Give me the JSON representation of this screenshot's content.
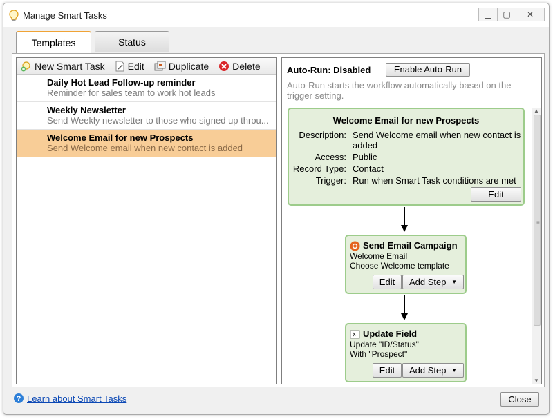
{
  "window": {
    "title": "Manage Smart Tasks"
  },
  "tabs": [
    {
      "label": "Templates"
    },
    {
      "label": "Status"
    }
  ],
  "toolbar": {
    "new_label": "New Smart Task",
    "edit_label": "Edit",
    "duplicate_label": "Duplicate",
    "delete_label": "Delete"
  },
  "tasks": [
    {
      "title": "Daily Hot Lead Follow-up reminder",
      "desc": "Reminder for sales team to work hot leads"
    },
    {
      "title": "Weekly Newsletter",
      "desc": "Send Weekly newsletter to those who signed up throu..."
    },
    {
      "title": "Welcome Email for new Prospects",
      "desc": "Send Welcome email when new contact is added"
    }
  ],
  "autorun": {
    "label": "Auto-Run: Disabled",
    "button": "Enable Auto-Run",
    "desc": "Auto-Run starts the workflow automatically based on the trigger setting."
  },
  "trigger_card": {
    "title": "Welcome Email for new Prospects",
    "description_key": "Description:",
    "description_val": "Send Welcome email when new contact is added",
    "access_key": "Access:",
    "access_val": "Public",
    "record_key": "Record Type:",
    "record_val": "Contact",
    "trigger_key": "Trigger:",
    "trigger_val": "Run when Smart Task conditions are met",
    "edit_label": "Edit"
  },
  "steps": [
    {
      "title": "Send Email Campaign",
      "line1": "Welcome Email",
      "line2": "Choose Welcome template",
      "edit": "Edit",
      "add": "Add Step"
    },
    {
      "title": "Update Field",
      "line1": "Update \"ID/Status\"",
      "line2": "With \"Prospect\"",
      "edit": "Edit",
      "add": "Add Step"
    }
  ],
  "footer": {
    "link": "Learn about Smart Tasks",
    "close": "Close"
  },
  "colors": {
    "accent": "#f8cd97",
    "card_border": "#9dcc8b",
    "card_bg": "#e5efdc",
    "link": "#0b48b5"
  }
}
